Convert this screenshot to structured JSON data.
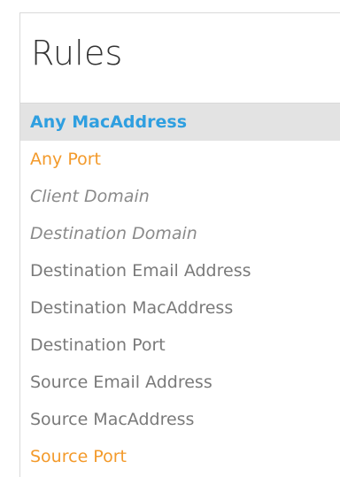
{
  "panel": {
    "title": "Rules"
  },
  "rules": [
    {
      "label": "Any MacAddress",
      "style": "selected"
    },
    {
      "label": "Any Port",
      "style": "orange"
    },
    {
      "label": "Client Domain",
      "style": "italic"
    },
    {
      "label": "Destination Domain",
      "style": "italic"
    },
    {
      "label": "Destination Email Address",
      "style": "normal"
    },
    {
      "label": "Destination MacAddress",
      "style": "normal"
    },
    {
      "label": "Destination Port",
      "style": "normal"
    },
    {
      "label": "Source Email Address",
      "style": "normal"
    },
    {
      "label": "Source MacAddress",
      "style": "normal"
    },
    {
      "label": "Source Port",
      "style": "orange"
    }
  ],
  "colors": {
    "selected_text": "#2f9fe0",
    "selected_background": "#e3e3e3",
    "orange_text": "#f39a2b",
    "muted_text": "#7a7a7a"
  }
}
